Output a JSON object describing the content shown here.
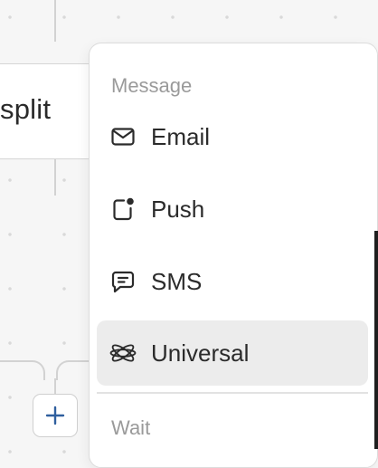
{
  "canvas": {
    "split_label": "split",
    "add_button_symbol": "+"
  },
  "menu": {
    "sections": [
      {
        "header": "Message"
      },
      {
        "header": "Wait"
      }
    ],
    "items": [
      {
        "label": "Email",
        "icon": "envelope-icon"
      },
      {
        "label": "Push",
        "icon": "push-notification-icon"
      },
      {
        "label": "SMS",
        "icon": "message-bubble-icon"
      },
      {
        "label": "Universal",
        "icon": "universal-orbit-icon",
        "selected": true
      }
    ]
  },
  "colors": {
    "canvas_bg": "#f6f6f6",
    "highlight": "#ececec",
    "add_button_accent": "#2f5f9e"
  }
}
